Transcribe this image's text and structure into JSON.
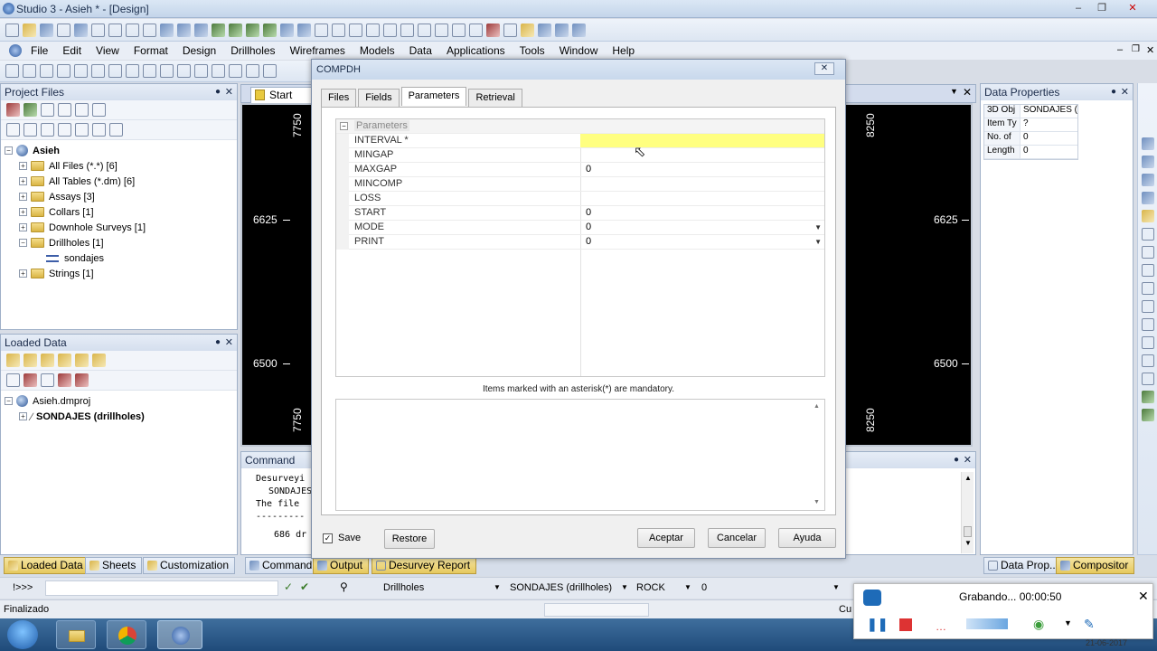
{
  "window": {
    "title": "Studio 3 - Asieh * - [Design]"
  },
  "menu": [
    "File",
    "Edit",
    "View",
    "Format",
    "Design",
    "Drillholes",
    "Wireframes",
    "Models",
    "Data",
    "Applications",
    "Tools",
    "Window",
    "Help"
  ],
  "project_files": {
    "title": "Project Files",
    "root": "Asieh",
    "items": [
      {
        "label": "All Files (*.*) [6]",
        "expander": "+"
      },
      {
        "label": "All Tables (*.dm) [6]",
        "expander": "+"
      },
      {
        "label": "Assays [3]",
        "expander": "+"
      },
      {
        "label": "Collars [1]",
        "expander": "+"
      },
      {
        "label": "Downhole Surveys [1]",
        "expander": "+"
      },
      {
        "label": "Drillholes [1]",
        "expander": "−"
      },
      {
        "label": "sondajes",
        "expander": ""
      },
      {
        "label": "Strings [1]",
        "expander": "+"
      }
    ]
  },
  "loaded_data": {
    "title": "Loaded Data",
    "root": "Asieh.dmproj",
    "item": "SONDAJES (drillholes)"
  },
  "design_tab": {
    "label": "Start"
  },
  "plot": {
    "labels": {
      "top_left": "7750",
      "top_right": "8250",
      "bottom_left": "7750",
      "bottom_right": "8250",
      "y1": "6625",
      "y2": "6500"
    }
  },
  "data_properties": {
    "title": "Data Properties",
    "rows": [
      {
        "k": "3D Obj",
        "v": "SONDAJES ("
      },
      {
        "k": "Item Ty",
        "v": "?"
      },
      {
        "k": "No. of",
        "v": "0"
      },
      {
        "k": "Length",
        "v": "0"
      }
    ]
  },
  "command": {
    "title": "Command",
    "lines": [
      "Desurveyi",
      "SONDAJES",
      "The file ",
      "---------",
      "686 dr"
    ]
  },
  "dialog": {
    "title": "COMPDH",
    "tabs": [
      "Files",
      "Fields",
      "Parameters",
      "Retrieval"
    ],
    "active_tab": "Parameters",
    "group": "Parameters",
    "params": [
      {
        "name": "INTERVAL *",
        "value": "",
        "dropdown": false
      },
      {
        "name": "MINGAP",
        "value": "",
        "dropdown": false
      },
      {
        "name": "MAXGAP",
        "value": "0",
        "dropdown": false
      },
      {
        "name": "MINCOMP",
        "value": "",
        "dropdown": false
      },
      {
        "name": "LOSS",
        "value": "",
        "dropdown": false
      },
      {
        "name": "START",
        "value": "0",
        "dropdown": false
      },
      {
        "name": "MODE",
        "value": "0",
        "dropdown": true
      },
      {
        "name": "PRINT",
        "value": "0",
        "dropdown": true
      }
    ],
    "note": "Items marked with an asterisk(*) are mandatory.",
    "save_label": "Save",
    "restore_label": "Restore",
    "ok_label": "Aceptar",
    "cancel_label": "Cancelar",
    "help_label": "Ayuda"
  },
  "bottom_tabs_left": [
    "Loaded Data",
    "Sheets",
    "Customization"
  ],
  "bottom_tabs_mid": [
    "Command",
    "Output",
    "Desurvey Report"
  ],
  "bottom_tabs_right": [
    "Data Prop...",
    "Compositor"
  ],
  "cmdbar": {
    "prompt": "!>>>",
    "object_type": "Drillholes",
    "object": "SONDAJES (drillholes)",
    "column": "ROCK",
    "value": "0"
  },
  "status": {
    "text": "Finalizado",
    "right": "Cu"
  },
  "recorder": {
    "text": "Grabando... 00:00:50"
  },
  "clock": {
    "date": "21-06-2017"
  },
  "colors": {
    "highlight": "#ffff80",
    "accent": "#2f5ca2"
  }
}
